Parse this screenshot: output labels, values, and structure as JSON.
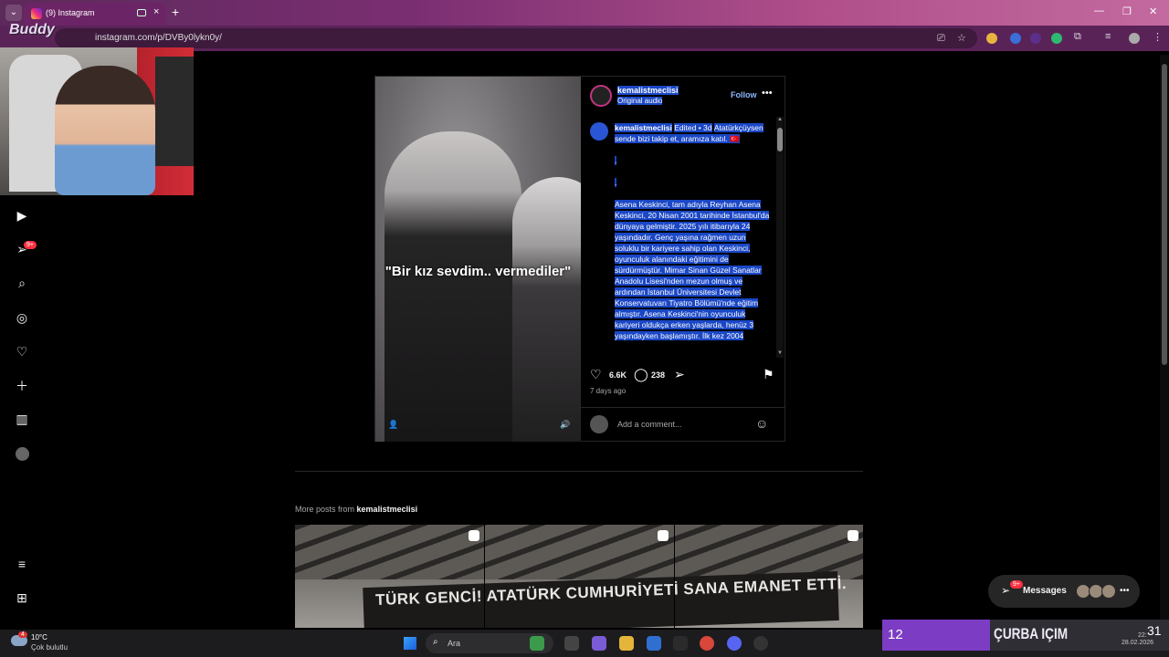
{
  "browser": {
    "tab_title": "(9) Instagram",
    "url": "instagram.com/p/DVBy0lykn0y/",
    "new_tab_label": "+",
    "tab_close": "×"
  },
  "stream": {
    "logo_text": "Buddy",
    "song_number": "12",
    "song_title": "ÇURBA IÇIM",
    "clock": "31",
    "clock_small": "22:",
    "date": "28.02.2026"
  },
  "sidebar": {
    "notifications_badge": "9+"
  },
  "post": {
    "username": "kemalistmeclisi",
    "audio": "Original audio",
    "follow_label": "Follow",
    "video_overlay": "\"Bir kız sevdim.. vermediler\"",
    "caption_user": "kemalistmeclisi",
    "caption_meta": "Edited • 3d",
    "caption_lines": [
      "Atatürkçüysen sende bizi takip et, aramıza katıl. 🇹🇷",
      ".",
      ".",
      "Asena Keskinci, tam adıyla Reyhan Asena Keskinci, 20 Nisan 2001 tarihinde İstanbul'da dünyaya gelmiştir. 2025 yılı itibarıyla 24 yaşındadır. Genç yaşına rağmen uzun soluklu bir kariyere sahip olan Keskinci, oyunculuk alanındaki eğitimini de sürdürmüştür. Mimar Sinan Güzel Sanatlar Anadolu Lisesi'nden mezun olmuş ve ardından İstanbul Üniversitesi Devlet Konservatuvarı Tiyatro Bölümü'nde eğitim almıştır. Asena Keskinci'nin oyunculuk kariyeri oldukça erken yaşlarda, henüz 3 yaşındayken başlamıştır. İlk kez 2004"
    ],
    "likes": "6.6K",
    "comments": "238",
    "time_ago": "7 days ago",
    "comment_placeholder": "Add a comment..."
  },
  "more_posts": {
    "prefix": "More posts from",
    "user": "kemalistmeclisi",
    "banner_text": "TÜRK GENCİ! ATATÜRK CUMHURİYETİ SANA EMANET ETTİ."
  },
  "messages": {
    "label": "Messages",
    "badge": "9+"
  },
  "taskbar": {
    "temperature": "10°C",
    "weather": "Çok bulutlu",
    "weather_badge": "4",
    "search_placeholder": "Ara"
  },
  "colors": {
    "selection": "#1a47c6",
    "follow": "#8fb7ff",
    "badge": "#ff3040",
    "song_panel": "#7c3cc4"
  }
}
